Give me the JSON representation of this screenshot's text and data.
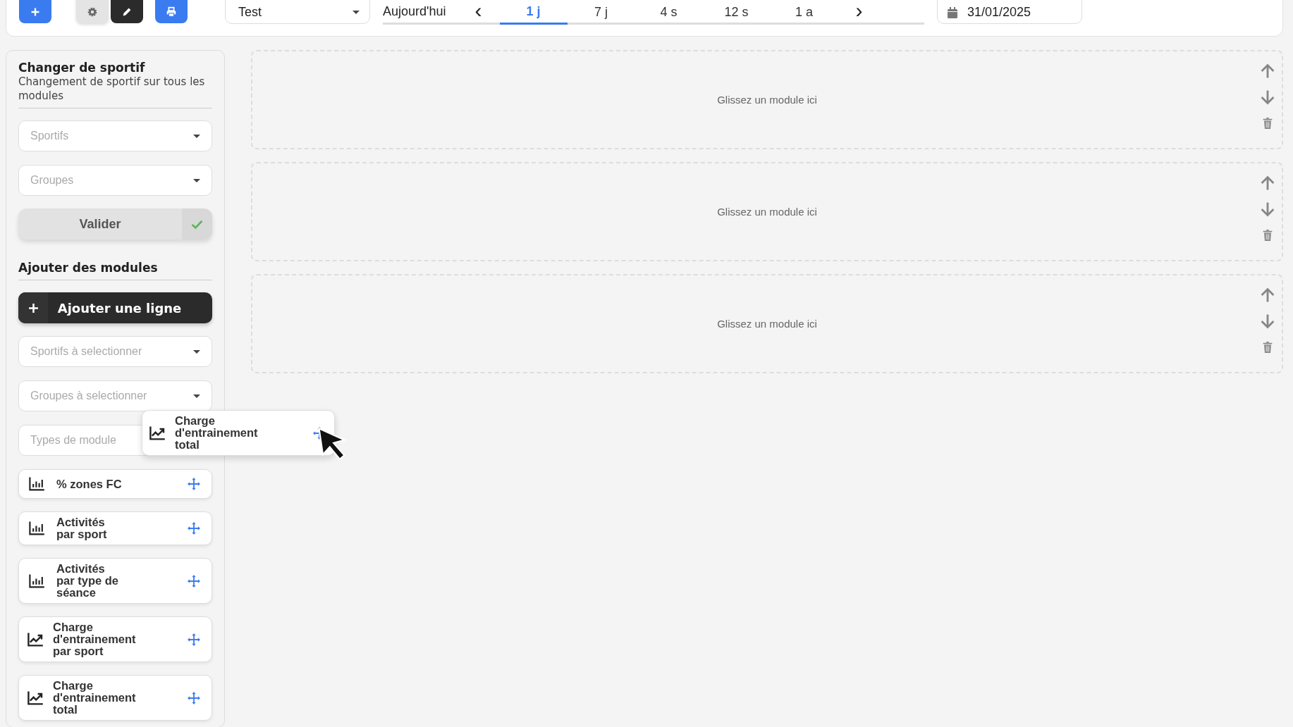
{
  "toolbar": {
    "buttons": [
      {
        "kind": "add"
      },
      {
        "kind": "settings"
      },
      {
        "kind": "edit"
      },
      {
        "kind": "print"
      }
    ],
    "dashboard_select": {
      "value": "Test"
    },
    "periods": {
      "today": "Aujourd'hui",
      "prev": "‹",
      "next": "›",
      "tabs": [
        {
          "label": "1 j",
          "selected": true
        },
        {
          "label": "7 j",
          "selected": false
        },
        {
          "label": "4 s",
          "selected": false
        },
        {
          "label": "12 s",
          "selected": false
        },
        {
          "label": "1 a",
          "selected": false
        }
      ]
    },
    "date": {
      "value": "31/01/2025"
    }
  },
  "sidebar": {
    "change_athlete": {
      "title": "Changer de sportif",
      "subtitle": "Changement de sportif sur tous les modules",
      "selects": [
        {
          "placeholder": "Sportifs"
        },
        {
          "placeholder": "Groupes"
        }
      ],
      "validate_button": "Valider"
    },
    "add_modules": {
      "title": "Ajouter des modules",
      "add_row_button": "Ajouter une ligne",
      "selects": [
        {
          "placeholder": "Sportifs à selectionner"
        },
        {
          "placeholder": "Groupes à selectionner"
        },
        {
          "placeholder": "Types de module"
        }
      ],
      "modules": [
        {
          "label": "% zones FC",
          "kind": "bar"
        },
        {
          "label": "Activités\npar sport",
          "kind": "bar"
        },
        {
          "label": "Activités\npar type de\nséance",
          "kind": "bar"
        },
        {
          "label": "Charge\nd'entrainement\npar sport",
          "kind": "line"
        },
        {
          "label": "Charge\nd'entrainement\ntotal",
          "kind": "line"
        }
      ]
    }
  },
  "dragged_module": {
    "label": "Charge\nd'entrainement\ntotal",
    "kind": "line"
  },
  "dropzones": [
    {
      "text": "Glissez un module ici"
    },
    {
      "text": "Glissez un module ici"
    },
    {
      "text": "Glissez un module ici"
    }
  ]
}
